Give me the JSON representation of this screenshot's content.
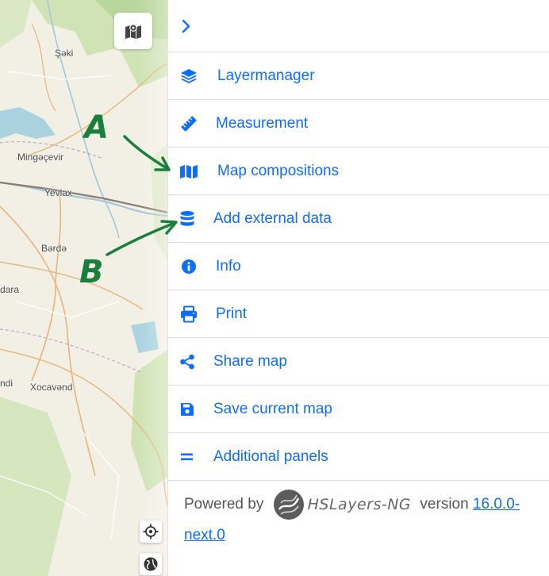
{
  "map": {
    "cities": [
      {
        "name": "Şəki"
      },
      {
        "name": "Mingəçevir"
      },
      {
        "name": "Yevlax"
      },
      {
        "name": "Bərdə"
      },
      {
        "name": "dara"
      },
      {
        "name": "Xocavənd"
      },
      {
        "name": "ndi"
      }
    ]
  },
  "menu": [
    {
      "label": "Layermanager",
      "icon": "layers-icon"
    },
    {
      "label": "Measurement",
      "icon": "ruler-icon"
    },
    {
      "label": "Map compositions",
      "icon": "map-icon"
    },
    {
      "label": "Add external data",
      "icon": "database-icon"
    },
    {
      "label": "Info",
      "icon": "info-icon"
    },
    {
      "label": "Print",
      "icon": "print-icon"
    },
    {
      "label": "Share map",
      "icon": "share-icon"
    },
    {
      "label": "Save current map",
      "icon": "save-icon"
    },
    {
      "label": "Additional panels",
      "icon": "equals-icon"
    }
  ],
  "footer": {
    "powered_by": "Powered by",
    "logo_text": "HSLayers-NG",
    "version_label": "version",
    "version": "16.0.0-next.0"
  },
  "annotations": {
    "label_a": "A",
    "label_b": "B"
  },
  "colors": {
    "accent": "#0d6efd",
    "annotation": "#1a7f3c",
    "map_background": "#f2efe5",
    "water": "#aad3df",
    "forest": "#cde3b6"
  }
}
